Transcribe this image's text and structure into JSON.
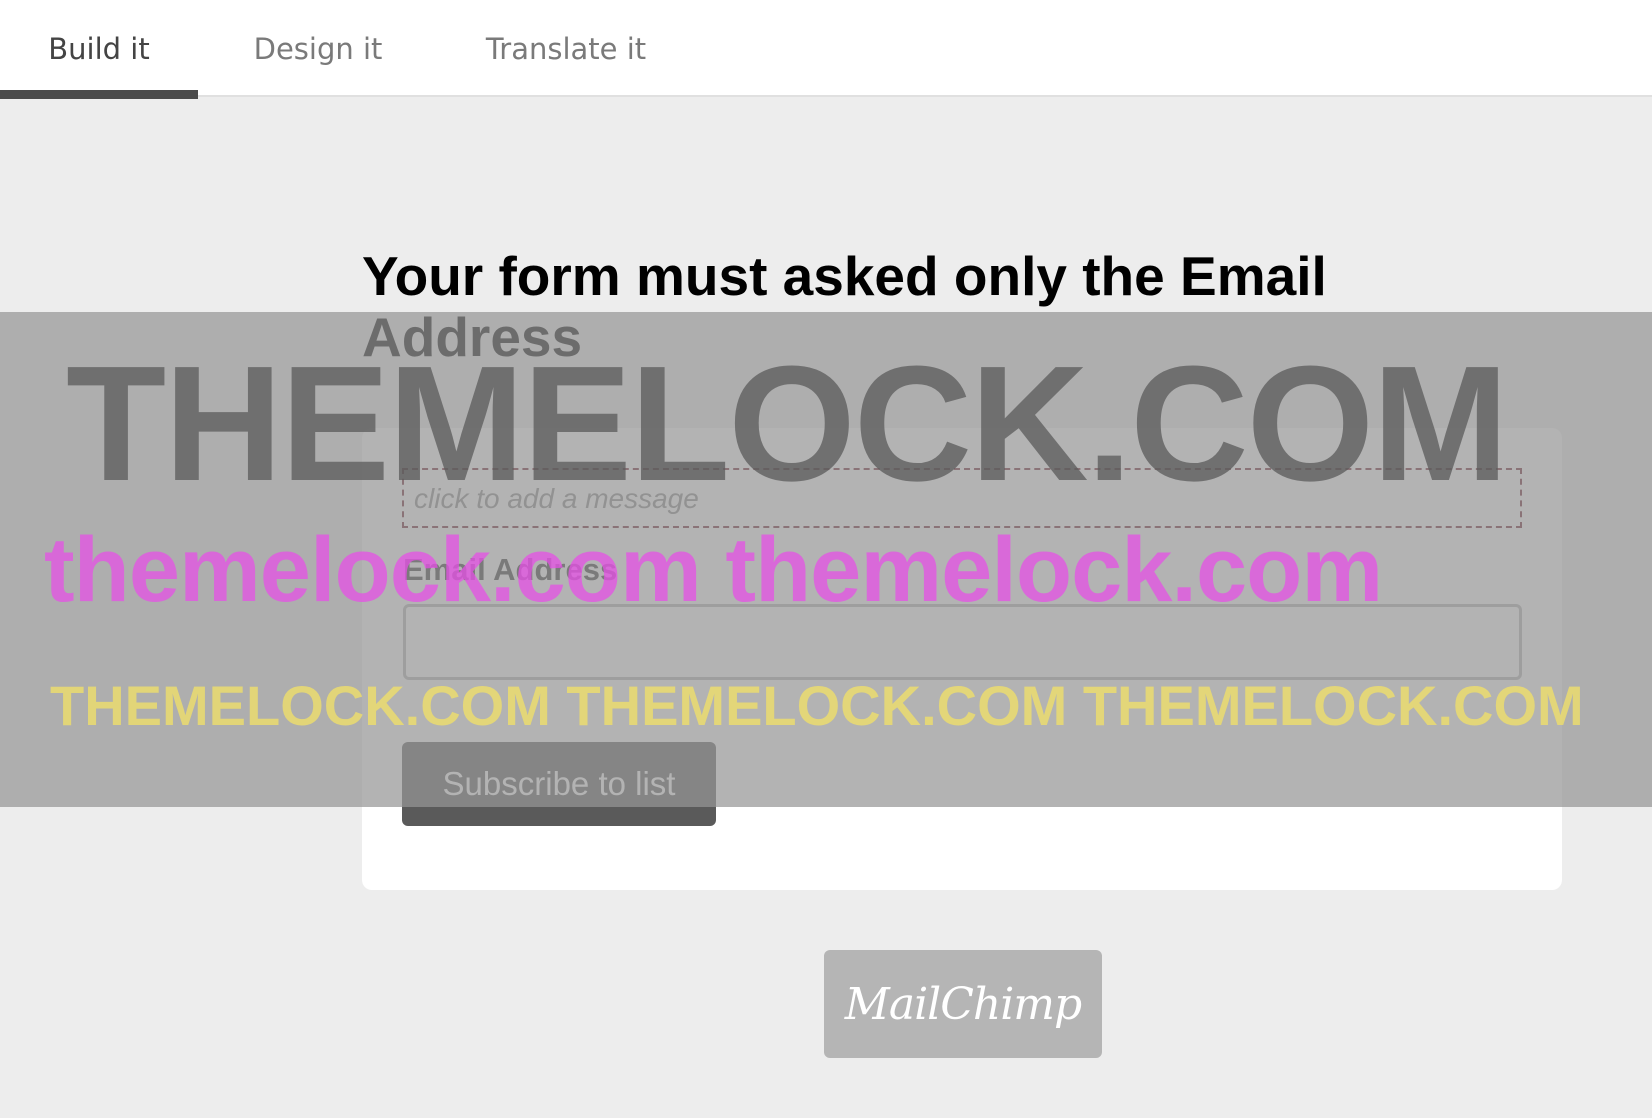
{
  "tabs": [
    {
      "label": "Build it",
      "active": true
    },
    {
      "label": "Design it",
      "active": false
    },
    {
      "label": "Translate it",
      "active": false
    }
  ],
  "form": {
    "title": "Your form must asked only the Email Address",
    "message_placeholder": "click to add a message",
    "email_label": "Email Address",
    "email_value": "",
    "subscribe_label": "Subscribe to list"
  },
  "branding": {
    "badge_label": "MailChimp"
  },
  "watermark": {
    "line1": "THEMELOCK.COM",
    "line2": "themelock.com themelock.com",
    "line3": "THEMELOCK.COM THEMELOCK.COM THEMELOCK.COM"
  },
  "colors": {
    "tab_indicator": "#4b4b4b",
    "message_border": "#6b1a2a",
    "button_bg": "#5a5a5a",
    "page_bg": "#ededed"
  }
}
